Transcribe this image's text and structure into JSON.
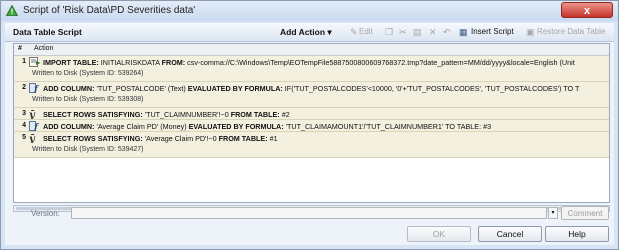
{
  "window": {
    "title": "Script of 'Risk Data\\PD Severities data'",
    "close": "x"
  },
  "toolbar": {
    "title": "Data Table Script",
    "add_action": "Add Action ▾",
    "edit": "Edit",
    "insert_script": "Insert Script",
    "restore": "Restore Data Table"
  },
  "grid": {
    "col_num": "#",
    "col_action": "Action",
    "rows": [
      {
        "num": "1",
        "kw1": "IMPORT TABLE:",
        "t1": " INITIALRISKDATA ",
        "kw2": "FROM:",
        "t2": " csv-comma://C:\\Windows\\Temp\\EOTempFile5887500800609768372.tmp?date_pattern=MM/dd/yyyy&locale=English (Unit",
        "line2": "Written to Disk (System ID: 539264)"
      },
      {
        "num": "2",
        "kw1": "ADD COLUMN:",
        "t1": " 'TUT_POSTALCODE' (Text) ",
        "kw2": "EVALUATED BY FORMULA:",
        "t2": " IF('TUT_POSTALCODES'<10000, '0'+'TUT_POSTALCODES', 'TUT_POSTALCODES') TO T",
        "line2": "Written to Disk (System ID: 539308)"
      },
      {
        "num": "3",
        "kw1": "SELECT ROWS SATISFYING:",
        "t1": " 'TUT_CLAIMNUMBER'!~0 ",
        "kw2": "FROM TABLE:",
        "t2": " #2",
        "line2": ""
      },
      {
        "num": "4",
        "kw1": "ADD COLUMN:",
        "t1": " 'Average Claim PD' (Money) ",
        "kw2": "EVALUATED BY FORMULA:",
        "t2": " 'TUT_CLAIMAMOUNT1'/'TUT_CLAIMNUMBER1' TO TABLE: #3",
        "line2": ""
      },
      {
        "num": "5",
        "kw1": "SELECT ROWS SATISFYING:",
        "t1": " 'Average Claim PD'!~0 ",
        "kw2": "FROM TABLE:",
        "t2": " #1",
        "line2": "Written to Disk (System ID: 539427)"
      }
    ]
  },
  "footer": {
    "version_label": "Version:",
    "comment": "Comment",
    "ok": "OK",
    "cancel": "Cancel",
    "help": "Help"
  }
}
